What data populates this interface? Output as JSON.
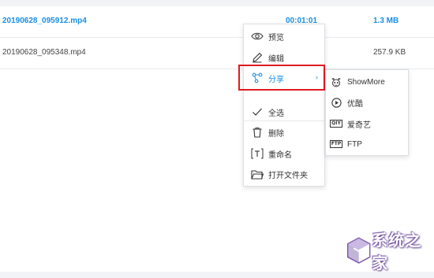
{
  "files": [
    {
      "name": "20190628_095912.mp4",
      "duration": "00:01:01",
      "size": "1.3 MB",
      "selected": true
    },
    {
      "name": "20190628_095348.mp4",
      "duration": "",
      "size": "257.9 KB",
      "selected": false
    }
  ],
  "context_menu": {
    "items": [
      {
        "label": "预览",
        "icon": "eye-icon"
      },
      {
        "label": "编辑",
        "icon": "pencil-icon"
      },
      {
        "label": "分享",
        "icon": "share-icon",
        "active": true,
        "has_submenu": true
      },
      {
        "label": "全选",
        "icon": "check-icon"
      },
      {
        "label": "删除",
        "icon": "trash-icon"
      },
      {
        "label": "重命名",
        "icon": "rename-icon"
      },
      {
        "label": "打开文件夹",
        "icon": "folder-icon"
      }
    ],
    "chevron": "›"
  },
  "share_submenu": {
    "items": [
      {
        "label": "ShowMore",
        "icon": "showmore-icon"
      },
      {
        "label": "优酷",
        "icon": "youku-play-icon"
      },
      {
        "label": "爱奇艺",
        "icon": "iqiyi-icon",
        "tag": "QIY"
      },
      {
        "label": "FTP",
        "icon": "ftp-icon",
        "tag": "FTP"
      }
    ]
  },
  "watermark": {
    "text": "系统之家"
  },
  "colors": {
    "accent": "#1a8ee6",
    "highlight": "#e0191f",
    "watermark": "#7a5aa8"
  }
}
